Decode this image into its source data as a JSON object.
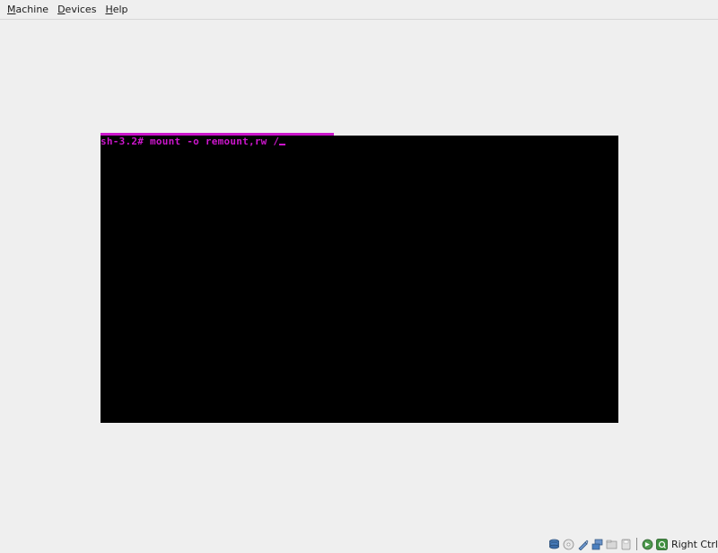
{
  "menubar": {
    "items": [
      {
        "mnemonic": "M",
        "rest": "achine"
      },
      {
        "mnemonic": "D",
        "rest": "evices"
      },
      {
        "mnemonic": "H",
        "rest": "elp"
      }
    ]
  },
  "console": {
    "line": "sh-3.2# mount -o remount,rw /",
    "text_color": "#cc16cc",
    "background": "#000000"
  },
  "statusbar": {
    "icons": [
      "hard-disk-icon",
      "optical-drive-icon",
      "usb-icon",
      "network-icon",
      "shared-folders-icon",
      "floppy-icon",
      "mouse-integration-icon",
      "host-key-icon"
    ],
    "host_key_label": "Right Ctrl"
  },
  "colors": {
    "accent": "#cc16cc",
    "window_bg": "#efefef"
  }
}
